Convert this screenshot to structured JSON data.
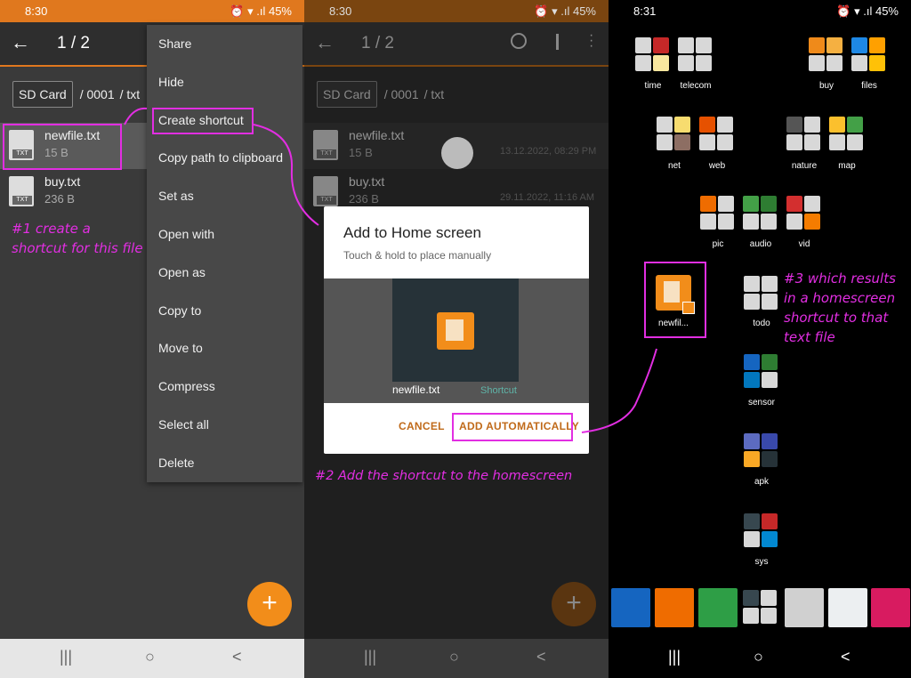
{
  "panel1": {
    "status": {
      "time": "8:30",
      "indicators": "⏰ ▾ .ıl 45%"
    },
    "toolbar": {
      "back": "←",
      "count": "1 / 2"
    },
    "breadcrumb": {
      "root": "SD Card",
      "dir1": "/ 0001",
      "dir2": "/ txt"
    },
    "files": [
      {
        "name": "newfile.txt",
        "size": "15 B"
      },
      {
        "name": "buy.txt",
        "size": "236 B"
      }
    ],
    "menu": [
      "Share",
      "Hide",
      "Create shortcut",
      "Copy path to clipboard",
      "Set as",
      "Open with",
      "Open as",
      "Copy to",
      "Move to",
      "Compress",
      "Select all",
      "Delete"
    ],
    "annotation": "#1 create a shortcut for this file",
    "fab": "+"
  },
  "panel2": {
    "status": {
      "time": "8:30",
      "indicators": "⏰ ▾ .ıl 45%"
    },
    "toolbar": {
      "back": "←",
      "count": "1 / 2"
    },
    "breadcrumb": {
      "root": "SD Card",
      "dir1": "/ 0001",
      "dir2": "/ txt"
    },
    "files": [
      {
        "name": "newfile.txt",
        "size": "15 B",
        "date": "13.12.2022, 08:29 PM"
      },
      {
        "name": "buy.txt",
        "size": "236 B",
        "date": "29.11.2022, 11:16 AM"
      }
    ],
    "dialog": {
      "title": "Add to Home screen",
      "subtitle": "Touch & hold to place manually",
      "preview_name": "newfile.txt",
      "preview_type": "Shortcut",
      "cancel": "CANCEL",
      "add": "ADD AUTOMATICALLY"
    },
    "annotation": "#2 Add the shortcut to the homescreen",
    "fab": "+"
  },
  "panel3": {
    "status": {
      "time": "8:31",
      "indicators": "⏰ ▾ .ıl 45%"
    },
    "folders": [
      "time",
      "telecom",
      "buy",
      "files",
      "net",
      "web",
      "nature",
      "map",
      "pic",
      "audio",
      "vid",
      "todo",
      "sensor",
      "apk",
      "sys"
    ],
    "shortcut_label": "newfil...",
    "annotation": "#3 which results in a homescreen shortcut to that text file"
  },
  "nav": {
    "recent": "|||",
    "home": "○",
    "back": "<"
  },
  "colors": {
    "accent": "#e0781e",
    "annotation": "#e22ee2"
  }
}
